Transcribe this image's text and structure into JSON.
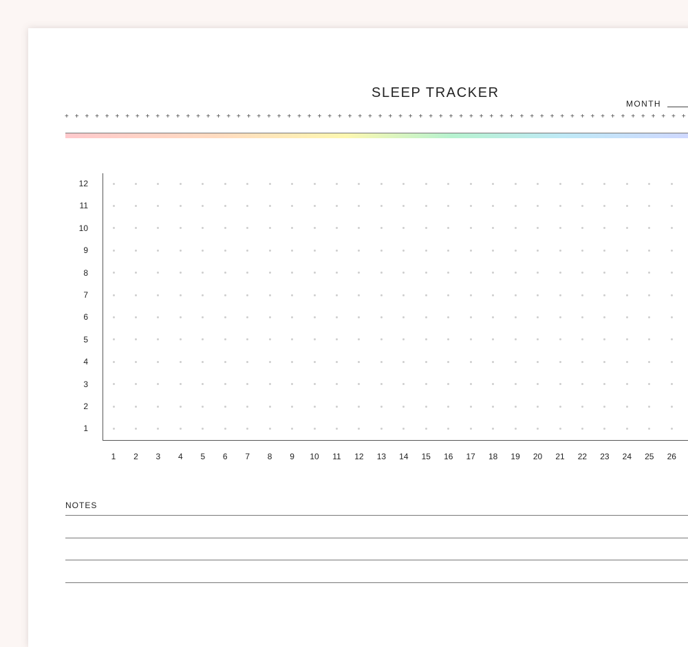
{
  "header": {
    "title": "SLEEP TRACKER",
    "month_label": "MONTH"
  },
  "colors": {
    "background": "#fcf6f4",
    "rainbow": [
      "#ffc9cc",
      "#ffdcc0",
      "#fdf7b0",
      "#b6f2cf",
      "#bfe9f6",
      "#cfd8ff"
    ],
    "dot": "#cfcfcf"
  },
  "grid": {
    "hours": [
      "12",
      "11",
      "10",
      "9",
      "8",
      "7",
      "6",
      "5",
      "4",
      "3",
      "2",
      "1"
    ],
    "days": [
      "1",
      "2",
      "3",
      "4",
      "5",
      "6",
      "7",
      "8",
      "9",
      "10",
      "11",
      "12",
      "13",
      "14",
      "15",
      "16",
      "17",
      "18",
      "19",
      "20",
      "21",
      "22",
      "23",
      "24",
      "25",
      "26"
    ]
  },
  "notes": {
    "label": "NOTES",
    "lines": 4
  }
}
